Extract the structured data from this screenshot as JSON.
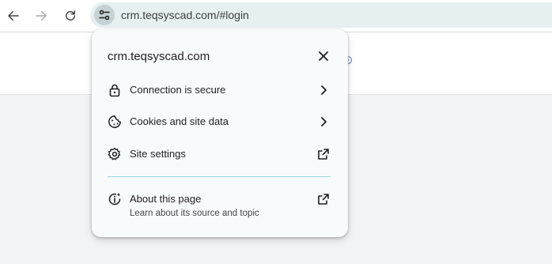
{
  "browser": {
    "url": "crm.teqsyscad.com/#login",
    "back_icon": "arrow-left-icon",
    "forward_icon": "arrow-right-icon",
    "reload_icon": "reload-icon",
    "site_info_icon": "tune-icon"
  },
  "site_popup": {
    "title": "crm.teqsyscad.com",
    "close_icon": "close-icon",
    "items": [
      {
        "label": "Connection is secure",
        "icon": "lock-icon",
        "trail_icon": "chevron-right-icon"
      },
      {
        "label": "Cookies and site data",
        "icon": "cookie-icon",
        "trail_icon": "chevron-right-icon"
      },
      {
        "label": "Site settings",
        "icon": "gear-icon",
        "trail_icon": "external-link-icon"
      }
    ],
    "about": {
      "label": "About this page",
      "sublabel": "Learn about its source and topic",
      "icon": "info-sparkle-icon",
      "trail_icon": "external-link-icon"
    }
  },
  "colors": {
    "omnibox_bg": "#e6f0f1",
    "popup_bg": "#f8fbfc",
    "divider": "#9ad6db",
    "page_bg": "#f1f3f4"
  }
}
